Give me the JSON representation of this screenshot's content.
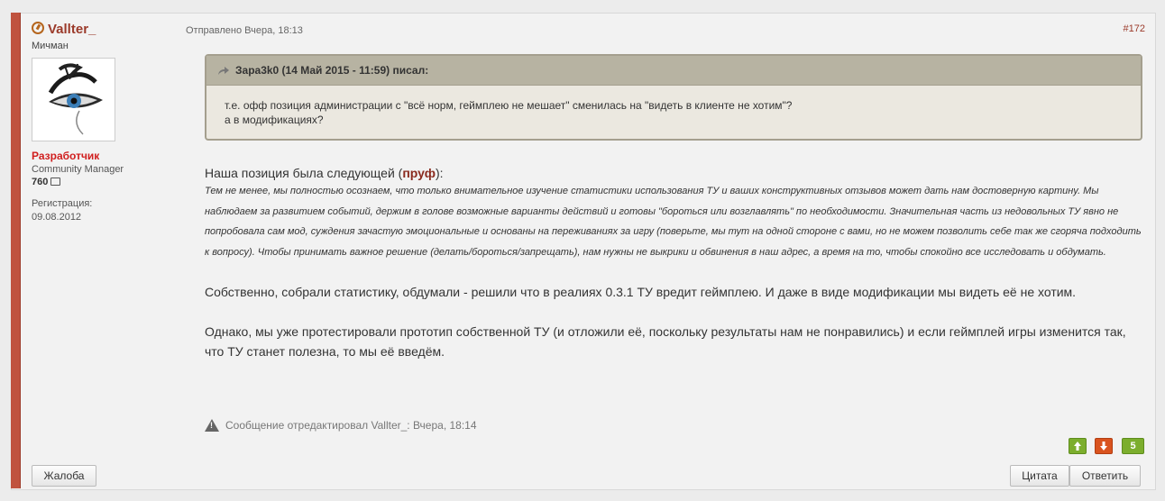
{
  "author": {
    "name": "Vallter_",
    "rank": "Мичман",
    "role": "Разработчик",
    "title": "Community Manager",
    "reputation": "760",
    "reg_label": "Регистрация:",
    "reg_date": "09.08.2012"
  },
  "post": {
    "date": "Отправлено Вчера, 18:13",
    "number": "#172"
  },
  "quote": {
    "header": "Зара3k0 (14 Май 2015 - 11:59) писал:",
    "line1": "т.е. офф позиция администрации с  \"всё норм, геймплею не мешает\" сменилась на \"видеть  в клиенте не хотим\"?",
    "line2": "а в модификациях?"
  },
  "content": {
    "lead_start": "Наша позиция была следующей (",
    "lead_link": "пруф",
    "lead_end": "):",
    "italic_text": "Тем не менее, мы полностью осознаем, что только внимательное изучение статистики использования ТУ и ваших конструктивных отзывов может дать нам достоверную картину. Мы наблюдаем за развитием событий, держим в голове возможные варианты действий и готовы \"бороться или возглавлять\" по необходимости. Значительная часть из недовольных ТУ явно не попробовала сам мод, суждения зачастую эмоциональные и основаны на переживаниях за игру (поверьте, мы тут на одной стороне с вами, но не можем позволить себе так же сгоряча подходить к вопросу). Чтобы принимать важное решение (делать/бороться/запрещать), нам нужны не выкрики и обвинения в наш адрес, а время на то, чтобы спокойно все исследовать и обдумать.",
    "para1": "Собственно, собрали статистику, обдумали - решили что в реалиях 0.3.1 ТУ вредит геймплею. И даже в виде модификации мы видеть её не хотим.",
    "para2": "Однако, мы уже протестировали прототип собственной ТУ (и отложили её, поскольку результаты нам не понравились) и если геймплей игры изменится так, что ТУ станет полезна, то мы её введём."
  },
  "edit_note": "Сообщение отредактировал Vallter_: Вчера, 18:14",
  "votes": {
    "count": "5"
  },
  "buttons": {
    "report": "Жалоба",
    "quote": "Цитата",
    "reply": "Ответить"
  }
}
